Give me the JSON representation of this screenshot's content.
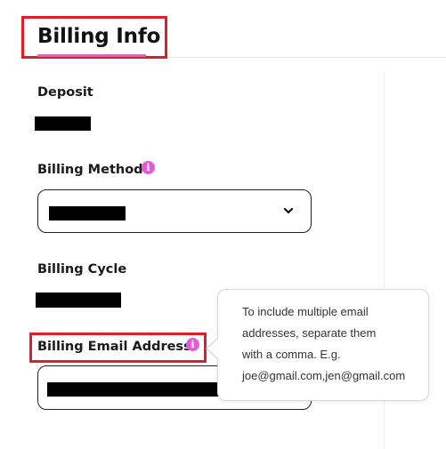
{
  "header": {
    "title": "Billing Info"
  },
  "fields": {
    "deposit": {
      "label": "Deposit"
    },
    "billing_method": {
      "label": "Billing Method",
      "info_icon": "info-icon"
    },
    "billing_cycle": {
      "label": "Billing Cycle"
    },
    "billing_email": {
      "label": "Billing Email Address",
      "info_icon": "info-icon"
    }
  },
  "tooltip": {
    "lines": [
      "To include multiple email",
      "addresses, separate them",
      "with a comma. E.g.",
      "joe@gmail.com,jen@gmail.com"
    ]
  },
  "icons": {
    "info_glyph": "i",
    "chevron": "chevron-down-icon"
  },
  "colors": {
    "accent": "#e25bd7",
    "highlight_box": "#e11d2a"
  }
}
